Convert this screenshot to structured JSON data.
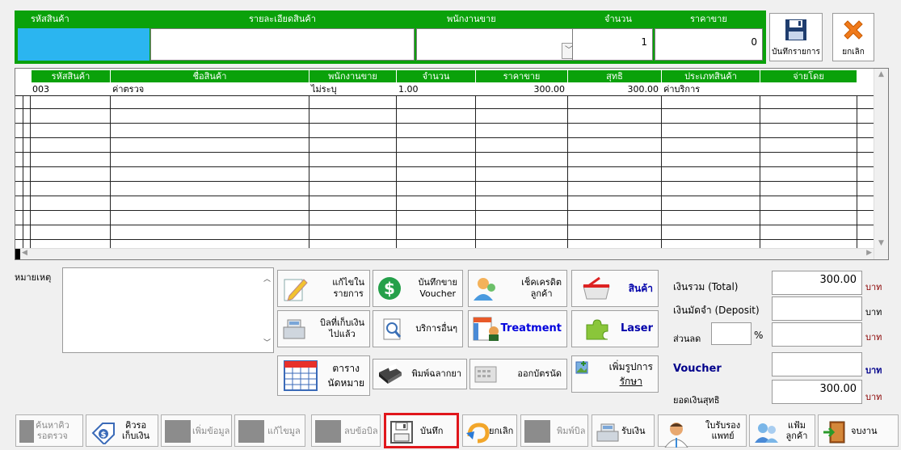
{
  "entry": {
    "headers": {
      "code": "รหัสสินค้า",
      "detail": "รายละเอียดสินค้า",
      "seller": "พนักงานขาย",
      "qty": "จำนวน",
      "price": "ราคาขาย"
    },
    "qty_value": "1",
    "price_value": "0",
    "save_item_label": "บันทึกรายการ",
    "cancel_label": "ยกเลิก"
  },
  "grid": {
    "columns": [
      "รหัสสินค้า",
      "ชื่อสินค้า",
      "พนักงานขาย",
      "จำนวน",
      "ราคาขาย",
      "สุทธิ",
      "ประเภทสินค้า",
      "จ่ายโดย"
    ],
    "rows": [
      {
        "code": "003",
        "name": "ค่าตรวจ",
        "seller": "ไม่ระบุ",
        "qty": "1.00",
        "price": "300.00",
        "net": "300.00",
        "type": "ค่าบริการ",
        "payby": ""
      }
    ]
  },
  "remarks": {
    "label": "หมายเหตุ"
  },
  "actions": {
    "edit_items": [
      "แก้ไขใน",
      "รายการ"
    ],
    "save_voucher": [
      "บันทึกขาย",
      "Voucher"
    ],
    "check_credit": [
      "เช็คเครดิต",
      "ลูกค้า"
    ],
    "products": "สินค้า",
    "paid_bills": [
      "บิลที่เก็บเงิน",
      "ไปแล้ว"
    ],
    "other_services": "บริการอื่นๆ",
    "treatment": "Treatment",
    "laser": "Laser",
    "appointments": [
      "ตาราง",
      "นัดหมาย"
    ],
    "print_label": "พิมพ์ฉลากยา",
    "appointment_card": "ออกบัตรนัด",
    "add_treatment_image": [
      "เพิ่มรูปการ",
      "รักษา"
    ]
  },
  "totals": {
    "total_label": "เงินรวม (Total)",
    "total_value": "300.00",
    "deposit_label": "เงินมัดจำ (Deposit)",
    "discount_label": "ส่วนลด",
    "percent": "%",
    "voucher_label": "Voucher",
    "net_label": "ยอดเงินสุทธิ",
    "net_value": "300.00",
    "currency": "บาท"
  },
  "toolbar": {
    "search_queue": [
      "ค้นหาคิว",
      "รอตรวจ"
    ],
    "pay_queue": [
      "คิวรอ",
      "เก็บเงิน"
    ],
    "add_data": "เพิ่มข้อมูล",
    "edit_data": "แก้ไขมูล",
    "delete_bill": "ลบข้อบิล",
    "save": "บันทึก",
    "cancel": "ยกเลิก",
    "print_bill": "พิมพ์บิล",
    "receive_payment": "รับเงิน",
    "doctor_cert": [
      "ใบรับรอง",
      "แพทย์"
    ],
    "customer_file": "แฟ้มลูกค้า",
    "exit": "จบงาน"
  },
  "colors": {
    "header_green": "#0aa10a",
    "code_blue": "#2bb5f0",
    "highlight_red": "#e0161b"
  }
}
